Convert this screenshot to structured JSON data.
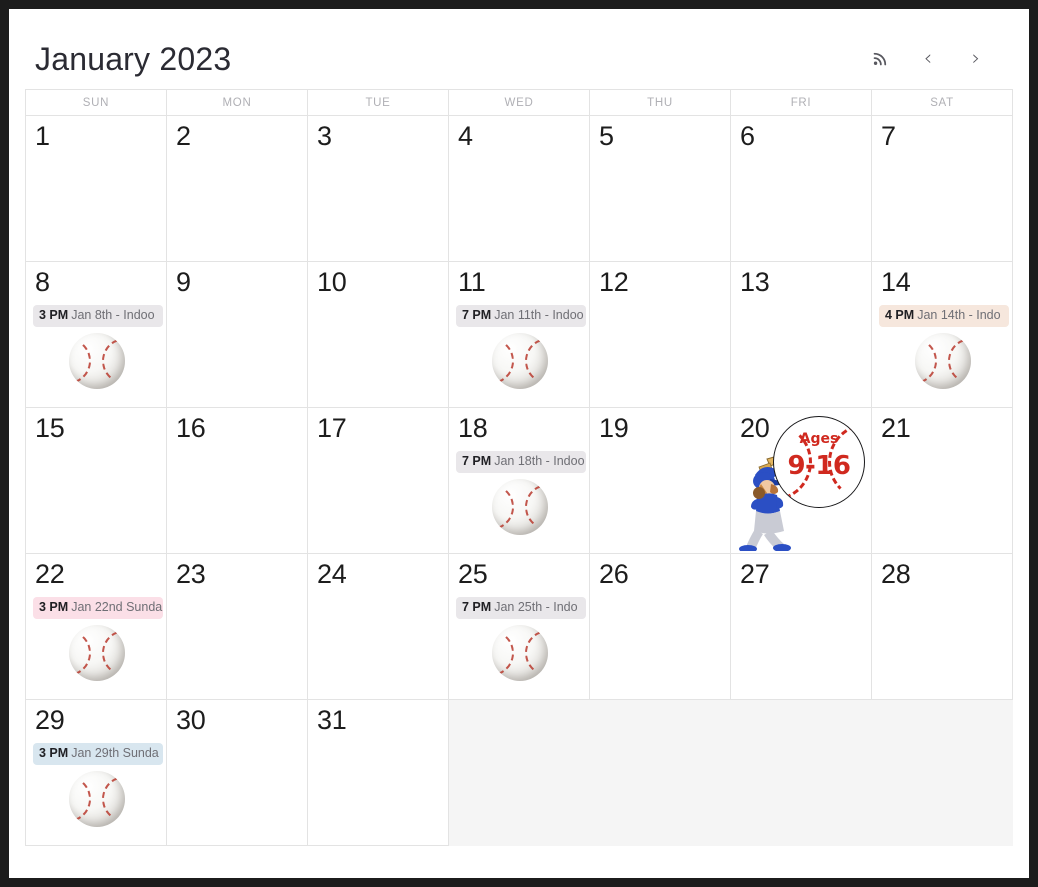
{
  "header": {
    "title": "January 2023",
    "rss_label": "rss-feed",
    "prev_label": "‹",
    "next_label": "›"
  },
  "weekday_headers": [
    "SUN",
    "MON",
    "TUE",
    "WED",
    "THU",
    "FRI",
    "SAT"
  ],
  "colors": {
    "page_background": "#ffffff",
    "outer_frame": "#1c1c1c",
    "grid_line": "#e3e3e3",
    "weekday_header_text": "#b0b0b5",
    "day_number_text": "#1d1d1d",
    "event_text": "#6f6f75",
    "event_time_text": "#202024",
    "chip_gray": "#e9e7ea",
    "chip_peach": "#f6e7dd",
    "chip_pink": "#fbdfe7",
    "chip_blue": "#d8e6ef",
    "trailing_cell": "#f5f5f5",
    "ages_red": "#d0291f"
  },
  "weeks": [
    {
      "days": [
        {
          "num": "1",
          "events": [],
          "image": null,
          "trailing": false
        },
        {
          "num": "2",
          "events": [],
          "image": null,
          "trailing": false
        },
        {
          "num": "3",
          "events": [],
          "image": null,
          "trailing": false
        },
        {
          "num": "4",
          "events": [],
          "image": null,
          "trailing": false
        },
        {
          "num": "5",
          "events": [],
          "image": null,
          "trailing": false
        },
        {
          "num": "6",
          "events": [],
          "image": null,
          "trailing": false
        },
        {
          "num": "7",
          "events": [],
          "image": null,
          "trailing": false
        }
      ]
    },
    {
      "days": [
        {
          "num": "8",
          "events": [
            {
              "time": "3 PM",
              "title": "Jan 8th - Indoo",
              "style": "chip-gray"
            }
          ],
          "image": "baseball",
          "trailing": false
        },
        {
          "num": "9",
          "events": [],
          "image": null,
          "trailing": false
        },
        {
          "num": "10",
          "events": [],
          "image": null,
          "trailing": false
        },
        {
          "num": "11",
          "events": [
            {
              "time": "7 PM",
              "title": "Jan 11th - Indoo",
              "style": "chip-gray"
            }
          ],
          "image": "baseball",
          "trailing": false
        },
        {
          "num": "12",
          "events": [],
          "image": null,
          "trailing": false
        },
        {
          "num": "13",
          "events": [],
          "image": null,
          "trailing": false
        },
        {
          "num": "14",
          "events": [
            {
              "time": "4 PM",
              "title": "Jan 14th - Indo",
              "style": "chip-peach"
            }
          ],
          "image": "baseball",
          "trailing": false
        }
      ]
    },
    {
      "days": [
        {
          "num": "15",
          "events": [],
          "image": null,
          "trailing": false
        },
        {
          "num": "16",
          "events": [],
          "image": null,
          "trailing": false
        },
        {
          "num": "17",
          "events": [],
          "image": null,
          "trailing": false
        },
        {
          "num": "18",
          "events": [
            {
              "time": "7 PM",
              "title": "Jan 18th - Indoo",
              "style": "chip-gray"
            }
          ],
          "image": "baseball",
          "trailing": false
        },
        {
          "num": "19",
          "events": [],
          "image": null,
          "trailing": false
        },
        {
          "num": "20",
          "events": [],
          "image": "ages-flyer",
          "trailing": false
        },
        {
          "num": "21",
          "events": [],
          "image": null,
          "trailing": false
        }
      ]
    },
    {
      "days": [
        {
          "num": "22",
          "events": [
            {
              "time": "3 PM",
              "title": "Jan 22nd Sunda",
              "style": "chip-pink"
            }
          ],
          "image": "baseball",
          "trailing": false
        },
        {
          "num": "23",
          "events": [],
          "image": null,
          "trailing": false
        },
        {
          "num": "24",
          "events": [],
          "image": null,
          "trailing": false
        },
        {
          "num": "25",
          "events": [
            {
              "time": "7 PM",
              "title": "Jan 25th - Indo",
              "style": "chip-gray"
            }
          ],
          "image": "baseball",
          "trailing": false
        },
        {
          "num": "26",
          "events": [],
          "image": null,
          "trailing": false
        },
        {
          "num": "27",
          "events": [],
          "image": null,
          "trailing": false
        },
        {
          "num": "28",
          "events": [],
          "image": null,
          "trailing": false
        }
      ]
    },
    {
      "days": [
        {
          "num": "29",
          "events": [
            {
              "time": "3 PM",
              "title": "Jan 29th Sunda",
              "style": "chip-blue"
            }
          ],
          "image": "baseball",
          "trailing": false
        },
        {
          "num": "30",
          "events": [],
          "image": null,
          "trailing": false
        },
        {
          "num": "31",
          "events": [],
          "image": null,
          "trailing": false
        },
        {
          "num": "",
          "events": [],
          "image": null,
          "trailing": true
        },
        {
          "num": "",
          "events": [],
          "image": null,
          "trailing": true
        },
        {
          "num": "",
          "events": [],
          "image": null,
          "trailing": true
        },
        {
          "num": "",
          "events": [],
          "image": null,
          "trailing": true
        }
      ]
    }
  ],
  "special_graphic": {
    "ages_label": "Ages",
    "ages_range": "9-16"
  }
}
